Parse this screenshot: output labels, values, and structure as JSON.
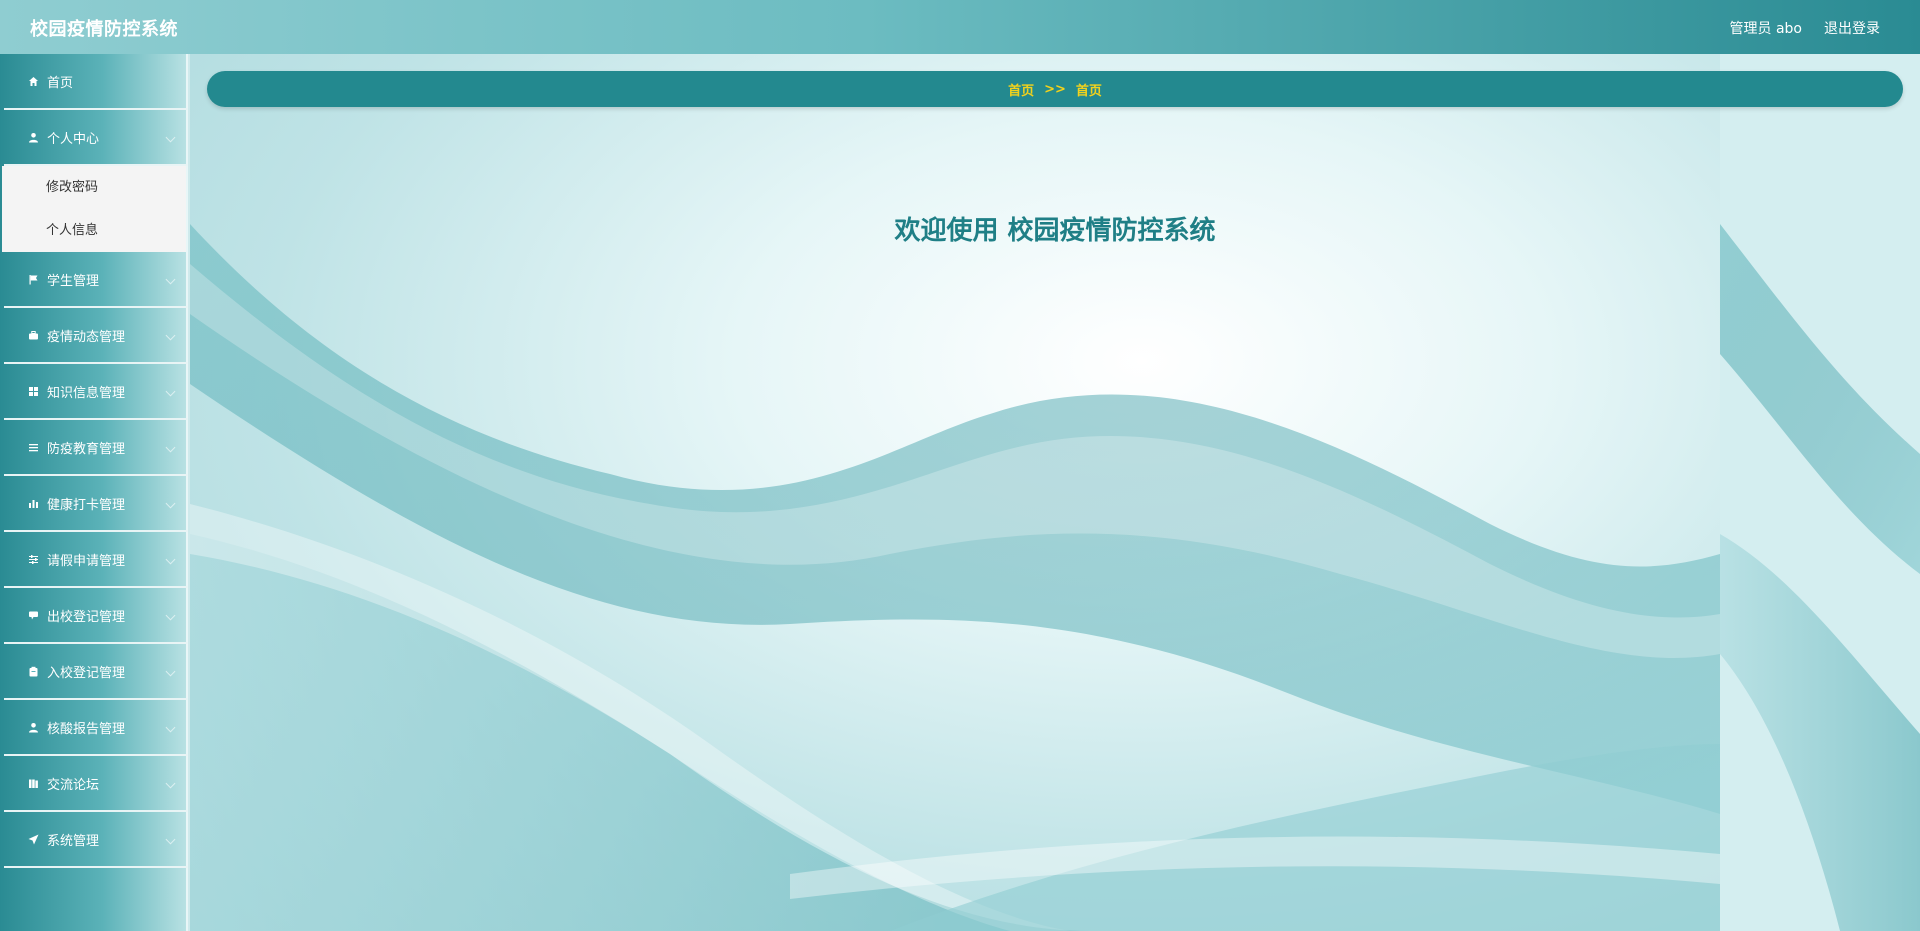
{
  "header": {
    "app_title": "校园疫情防控系统",
    "user_label": "管理员 abo",
    "logout_label": "退出登录"
  },
  "sidebar": {
    "items": [
      {
        "label": "首页",
        "icon": "home-icon"
      },
      {
        "label": "个人中心",
        "icon": "user-icon",
        "expanded": true,
        "children": [
          {
            "label": "修改密码"
          },
          {
            "label": "个人信息"
          }
        ]
      },
      {
        "label": "学生管理",
        "icon": "flag-icon"
      },
      {
        "label": "疫情动态管理",
        "icon": "briefcase-icon"
      },
      {
        "label": "知识信息管理",
        "icon": "grid-icon"
      },
      {
        "label": "防疫教育管理",
        "icon": "list-icon"
      },
      {
        "label": "健康打卡管理",
        "icon": "bar-chart-icon"
      },
      {
        "label": "请假申请管理",
        "icon": "sliders-icon"
      },
      {
        "label": "出校登记管理",
        "icon": "comment-icon"
      },
      {
        "label": "入校登记管理",
        "icon": "clipboard-icon"
      },
      {
        "label": "核酸报告管理",
        "icon": "user-icon"
      },
      {
        "label": "交流论坛",
        "icon": "book-icon"
      },
      {
        "label": "系统管理",
        "icon": "send-icon"
      }
    ]
  },
  "breadcrumb": {
    "first": "首页",
    "separator": ">>",
    "second": "首页"
  },
  "main": {
    "welcome_text": "欢迎使用 校园疫情防控系统"
  },
  "colors": {
    "accent": "#23898f",
    "breadcrumb_text": "#f2d21c",
    "welcome_text": "#1f7f86"
  }
}
